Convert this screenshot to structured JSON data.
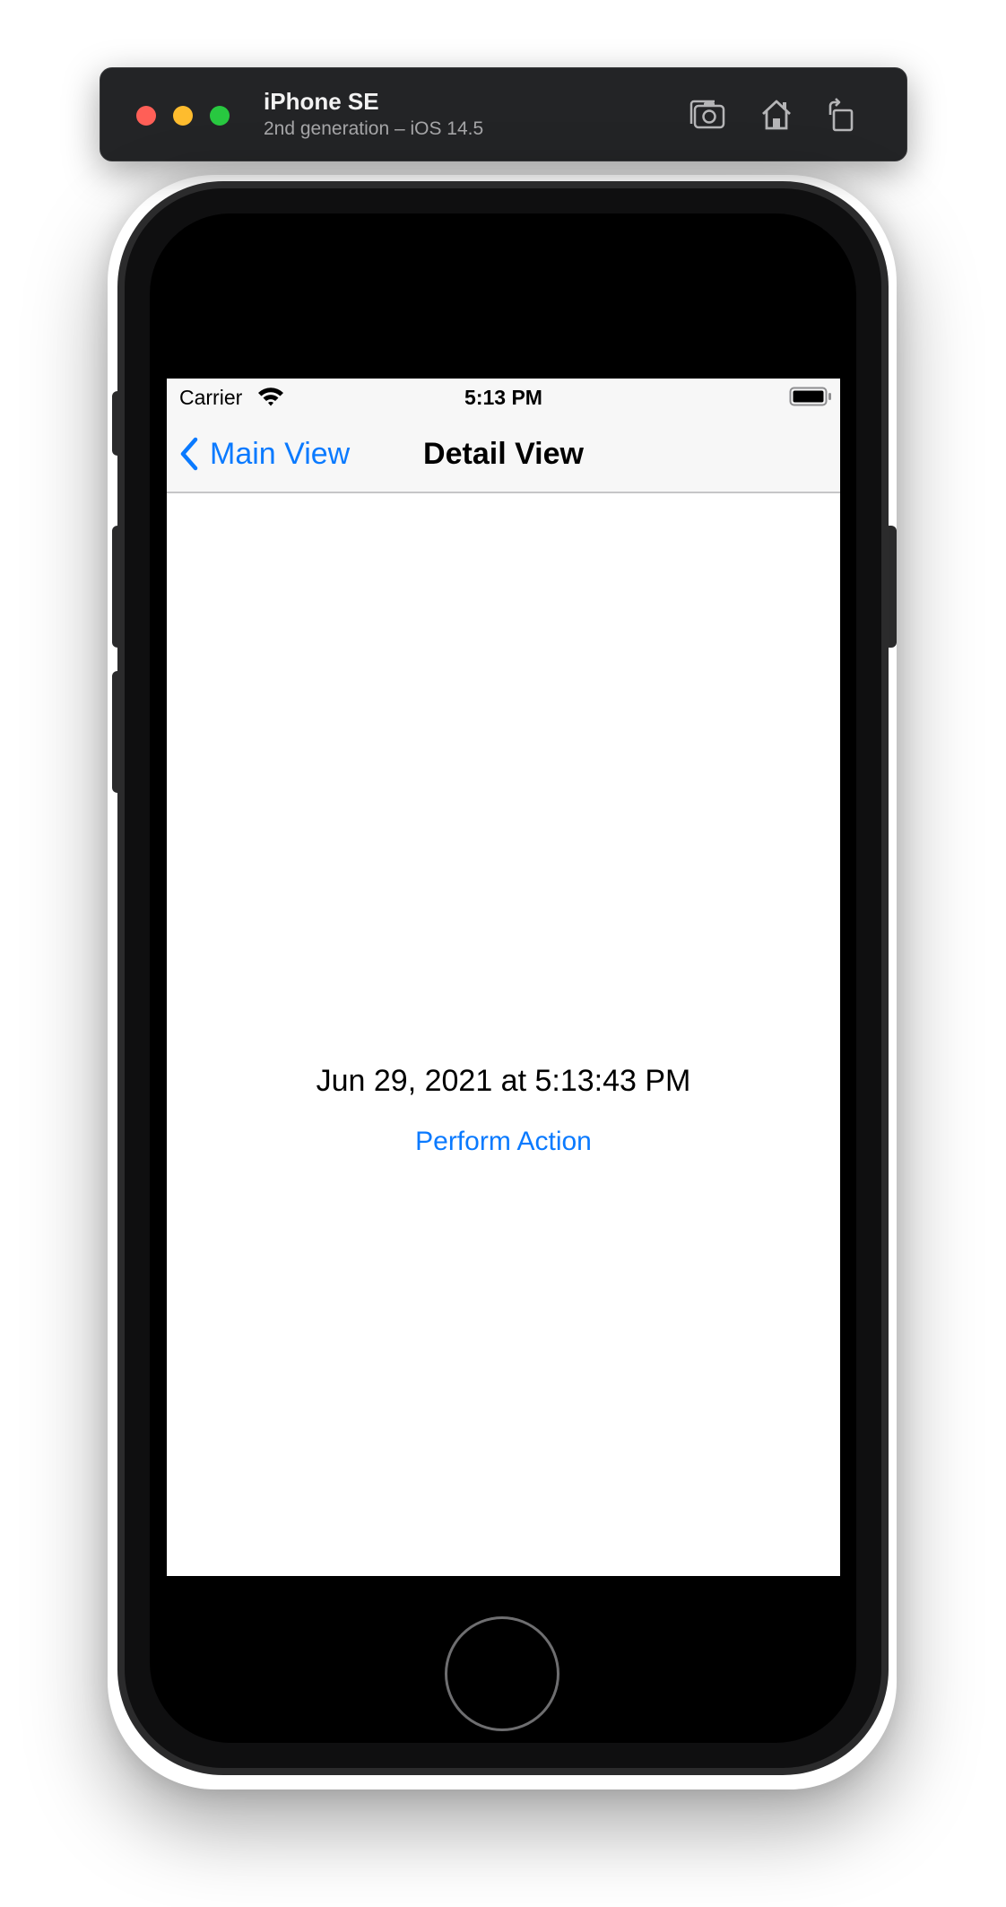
{
  "simulator": {
    "device_name": "iPhone SE",
    "device_subtitle": "2nd generation – iOS 14.5",
    "toolbar": [
      "screenshot-icon",
      "home-icon",
      "rotate-icon"
    ]
  },
  "status_bar": {
    "carrier": "Carrier",
    "time": "5:13 PM"
  },
  "nav": {
    "back_label": "Main View",
    "title": "Detail View"
  },
  "content": {
    "date_text": "Jun 29, 2021 at 5:13:43 PM",
    "action_label": "Perform Action"
  },
  "colors": {
    "tint": "#0a7aff",
    "bar_background": "#f7f7f7"
  }
}
